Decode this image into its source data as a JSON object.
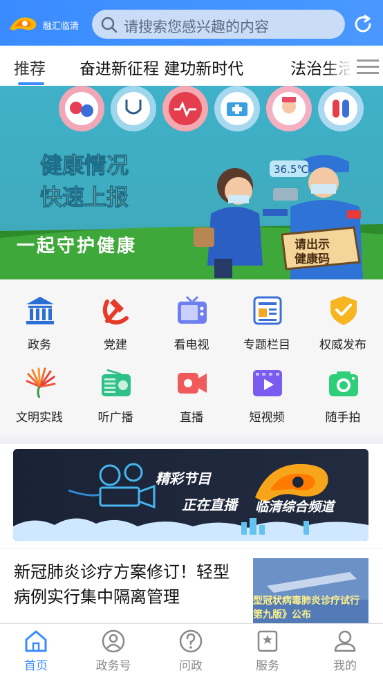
{
  "header": {
    "logo_text": "融汇临清",
    "search_placeholder": "请搜索您感兴趣的内容"
  },
  "tabs": [
    {
      "label": "推荐"
    },
    {
      "label": "奋进新征程 建功新时代"
    },
    {
      "label": "法治生活"
    }
  ],
  "banner": {
    "line1": "健康情况",
    "line2": "快速上报",
    "tagline": "一起守护健康",
    "temp": "36.5℃",
    "sign": "请出示健康码",
    "sign_line1": "请出示",
    "sign_line2": "健康码"
  },
  "grid": [
    {
      "label": "政务",
      "icon": "government-building-icon"
    },
    {
      "label": "党建",
      "icon": "party-emblem-icon"
    },
    {
      "label": "看电视",
      "icon": "tv-icon"
    },
    {
      "label": "专题栏目",
      "icon": "topics-icon"
    },
    {
      "label": "权威发布",
      "icon": "shield-check-icon"
    },
    {
      "label": "文明实践",
      "icon": "civilization-flower-icon"
    },
    {
      "label": "听广播",
      "icon": "radio-icon"
    },
    {
      "label": "直播",
      "icon": "live-icon"
    },
    {
      "label": "短视频",
      "icon": "video-play-icon"
    },
    {
      "label": "随手拍",
      "icon": "camera-icon"
    }
  ],
  "live_banner": {
    "line1": "精彩节目",
    "line2": "正在直播",
    "channel": "临清综合频道"
  },
  "news": {
    "title": "新冠肺炎诊疗方案修订！轻型病例实行集中隔离管理",
    "thumb_text": "型冠状病毒肺炎诊疗试行第九版》公布"
  },
  "bottom_nav": [
    {
      "label": "首页",
      "icon": "home-icon"
    },
    {
      "label": "政务号",
      "icon": "government-account-icon"
    },
    {
      "label": "问政",
      "icon": "question-icon"
    },
    {
      "label": "服务",
      "icon": "service-bookmark-icon"
    },
    {
      "label": "我的",
      "icon": "user-icon"
    }
  ],
  "colors": {
    "accent": "#3a8bff",
    "header": "#3d8eff"
  }
}
